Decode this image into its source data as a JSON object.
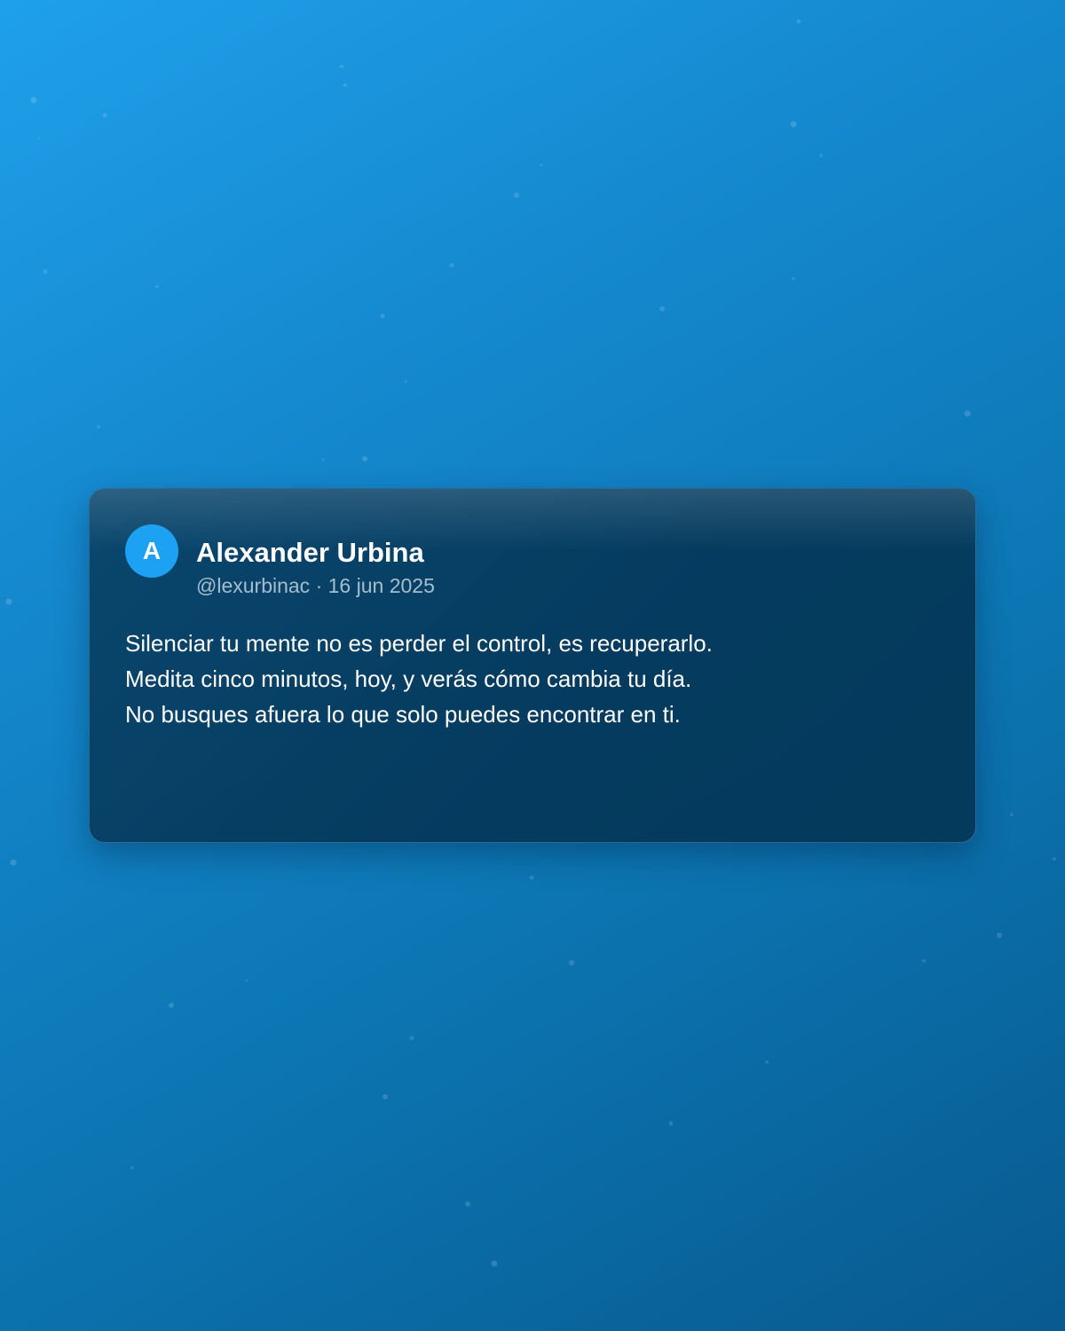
{
  "tweet": {
    "avatar_initial": "A",
    "author_name": "Alexander Urbina",
    "handle": "@lexurbinac",
    "separator": "·",
    "date": "16 jun 2025",
    "lines": [
      "Silenciar tu mente no es perder el control, es recuperarlo.",
      "Medita cinco minutos, hoy, y verás cómo cambia tu día.",
      "No busques afuera lo que solo puedes encontrar en ti."
    ]
  },
  "colors": {
    "background_top": "#1fa0ea",
    "background_bottom": "#085a8f",
    "card": "#063a5c",
    "avatar": "#1da1f2",
    "text": "#ffffff",
    "muted_text": "#b8cfe0"
  }
}
